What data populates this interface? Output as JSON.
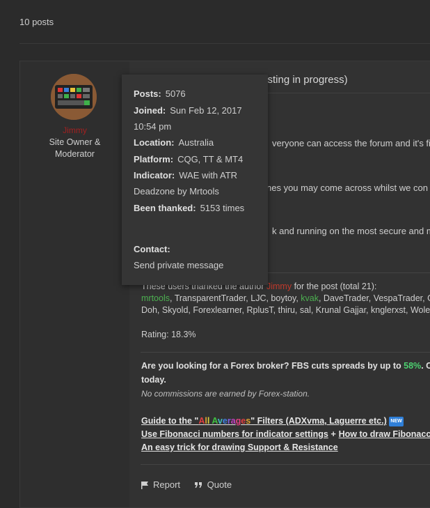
{
  "topic": {
    "posts_count": "10 posts"
  },
  "author": {
    "username": "Jimmy",
    "rank_line1": "Site Owner &",
    "rank_line2": "Moderator"
  },
  "post": {
    "title_visible": "testing in progress)",
    "line1": "veryone can access the forum and it's fi",
    "line2": "nes you may come across whilst we con",
    "line3": "k and running on the most secure and m",
    "thanks_prefix": "These users thanked the author ",
    "thanks_author": "Jimmy",
    "thanks_suffix": " for the post (total 21):",
    "thanks_u1": "mrtools",
    "thanks_mid1": ", TransparentTrader, LJC, boytoy, ",
    "thanks_u2": "kvak",
    "thanks_mid2": ", DaveTrader, VespaTrader, G",
    "thanks_line2": "Doh, Skyold, Forexlearner, RplusT, thiru, sal, Krunal Gajjar, knglerxst, Wole,",
    "rating": "Rating: 18.3%",
    "promo_prefix": "Are you looking for a Forex broker? FBS cuts spreads by up to ",
    "promo_percent": "58%",
    "promo_suffix": ". Clic",
    "promo_line2": "today.",
    "commission_note": "No commissions are earned by Forex-station.",
    "link1_prefix": "Guide to the \"",
    "link1_all": "All Averages",
    "link1_suffix": "\" Filters (ADXvma, Laguerre etc.)",
    "new_badge": "NEW",
    "link2_a": "Use Fibonacci numbers for indicator settings",
    "link2_plus": " + ",
    "link2_b": "How to draw Fibonacci Ex",
    "link3": "An easy trick for drawing Support & Resistance",
    "actions": {
      "report": "Report",
      "quote": "Quote"
    }
  },
  "profile_tooltip": {
    "posts_label": "Posts:",
    "posts_value": "5076",
    "joined_label": "Joined:",
    "joined_value": "Sun Feb 12, 2017",
    "joined_time": "10:54 pm",
    "location_label": "Location:",
    "location_value": "Australia",
    "platform_label": "Platform:",
    "platform_value": "CQG, TT & MT4",
    "indicator_label": "Indicator:",
    "indicator_value": "WAE with ATR",
    "indicator_value2": "Deadzone by Mrtools",
    "thanked_label": "Been thanked:",
    "thanked_value": "5153 times",
    "contact_label": "Contact:",
    "contact_link": "Send private message"
  },
  "colors": {
    "username": "#a32020",
    "green_user": "#4caf50",
    "promo_green": "#4cd070",
    "new_badge": "#2f7fd8"
  }
}
